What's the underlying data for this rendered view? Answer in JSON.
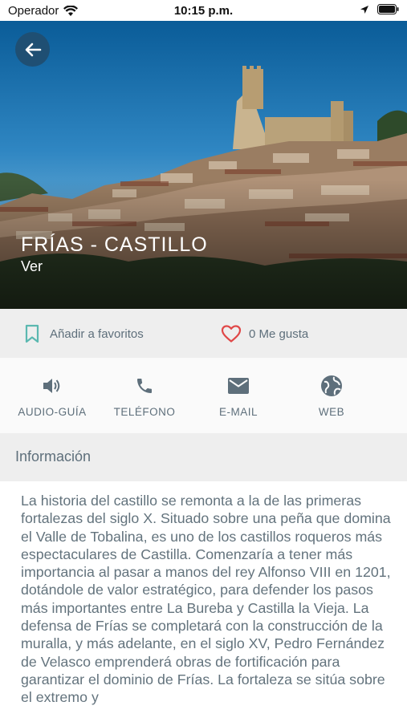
{
  "status_bar": {
    "carrier": "Operador",
    "time": "10:15 p.m."
  },
  "hero": {
    "title": "FRÍAS - CASTILLO",
    "subtitle": "Ver"
  },
  "actions": {
    "favorites_label": "Añadir a favoritos",
    "likes_label": "0 Me gusta"
  },
  "contact": {
    "items": [
      {
        "label": "AUDIO-GUÍA",
        "icon": "speaker-icon"
      },
      {
        "label": "TELÉFONO",
        "icon": "phone-icon"
      },
      {
        "label": "E-MAIL",
        "icon": "mail-icon"
      },
      {
        "label": "WEB",
        "icon": "globe-icon"
      }
    ]
  },
  "info": {
    "header": "Información",
    "text": "La historia del castillo se remonta a la de las primeras fortalezas del siglo X. Situado sobre una peña que domina el Valle de Tobalina, es uno de los castillos roqueros más espectaculares de Castilla. Comenzaría a tener más importancia al pasar a manos del rey Alfonso VIII en 1201, dotándole de valor estratégico, para defender los pasos más importantes entre La Bureba y Castilla la Vieja. La defensa de Frías se completará con la construcción de la muralla, y más adelante, en el siglo XV, Pedro Fernández de Velasco emprenderá obras de fortificación para garantizar el dominio de Frías. La fortaleza se sitúa sobre el extremo y"
  },
  "colors": {
    "accent_teal": "#5bb8b0",
    "heart_red": "#e04848",
    "icon_gray": "#5e6f7b",
    "back_button": "#1f4f73"
  }
}
